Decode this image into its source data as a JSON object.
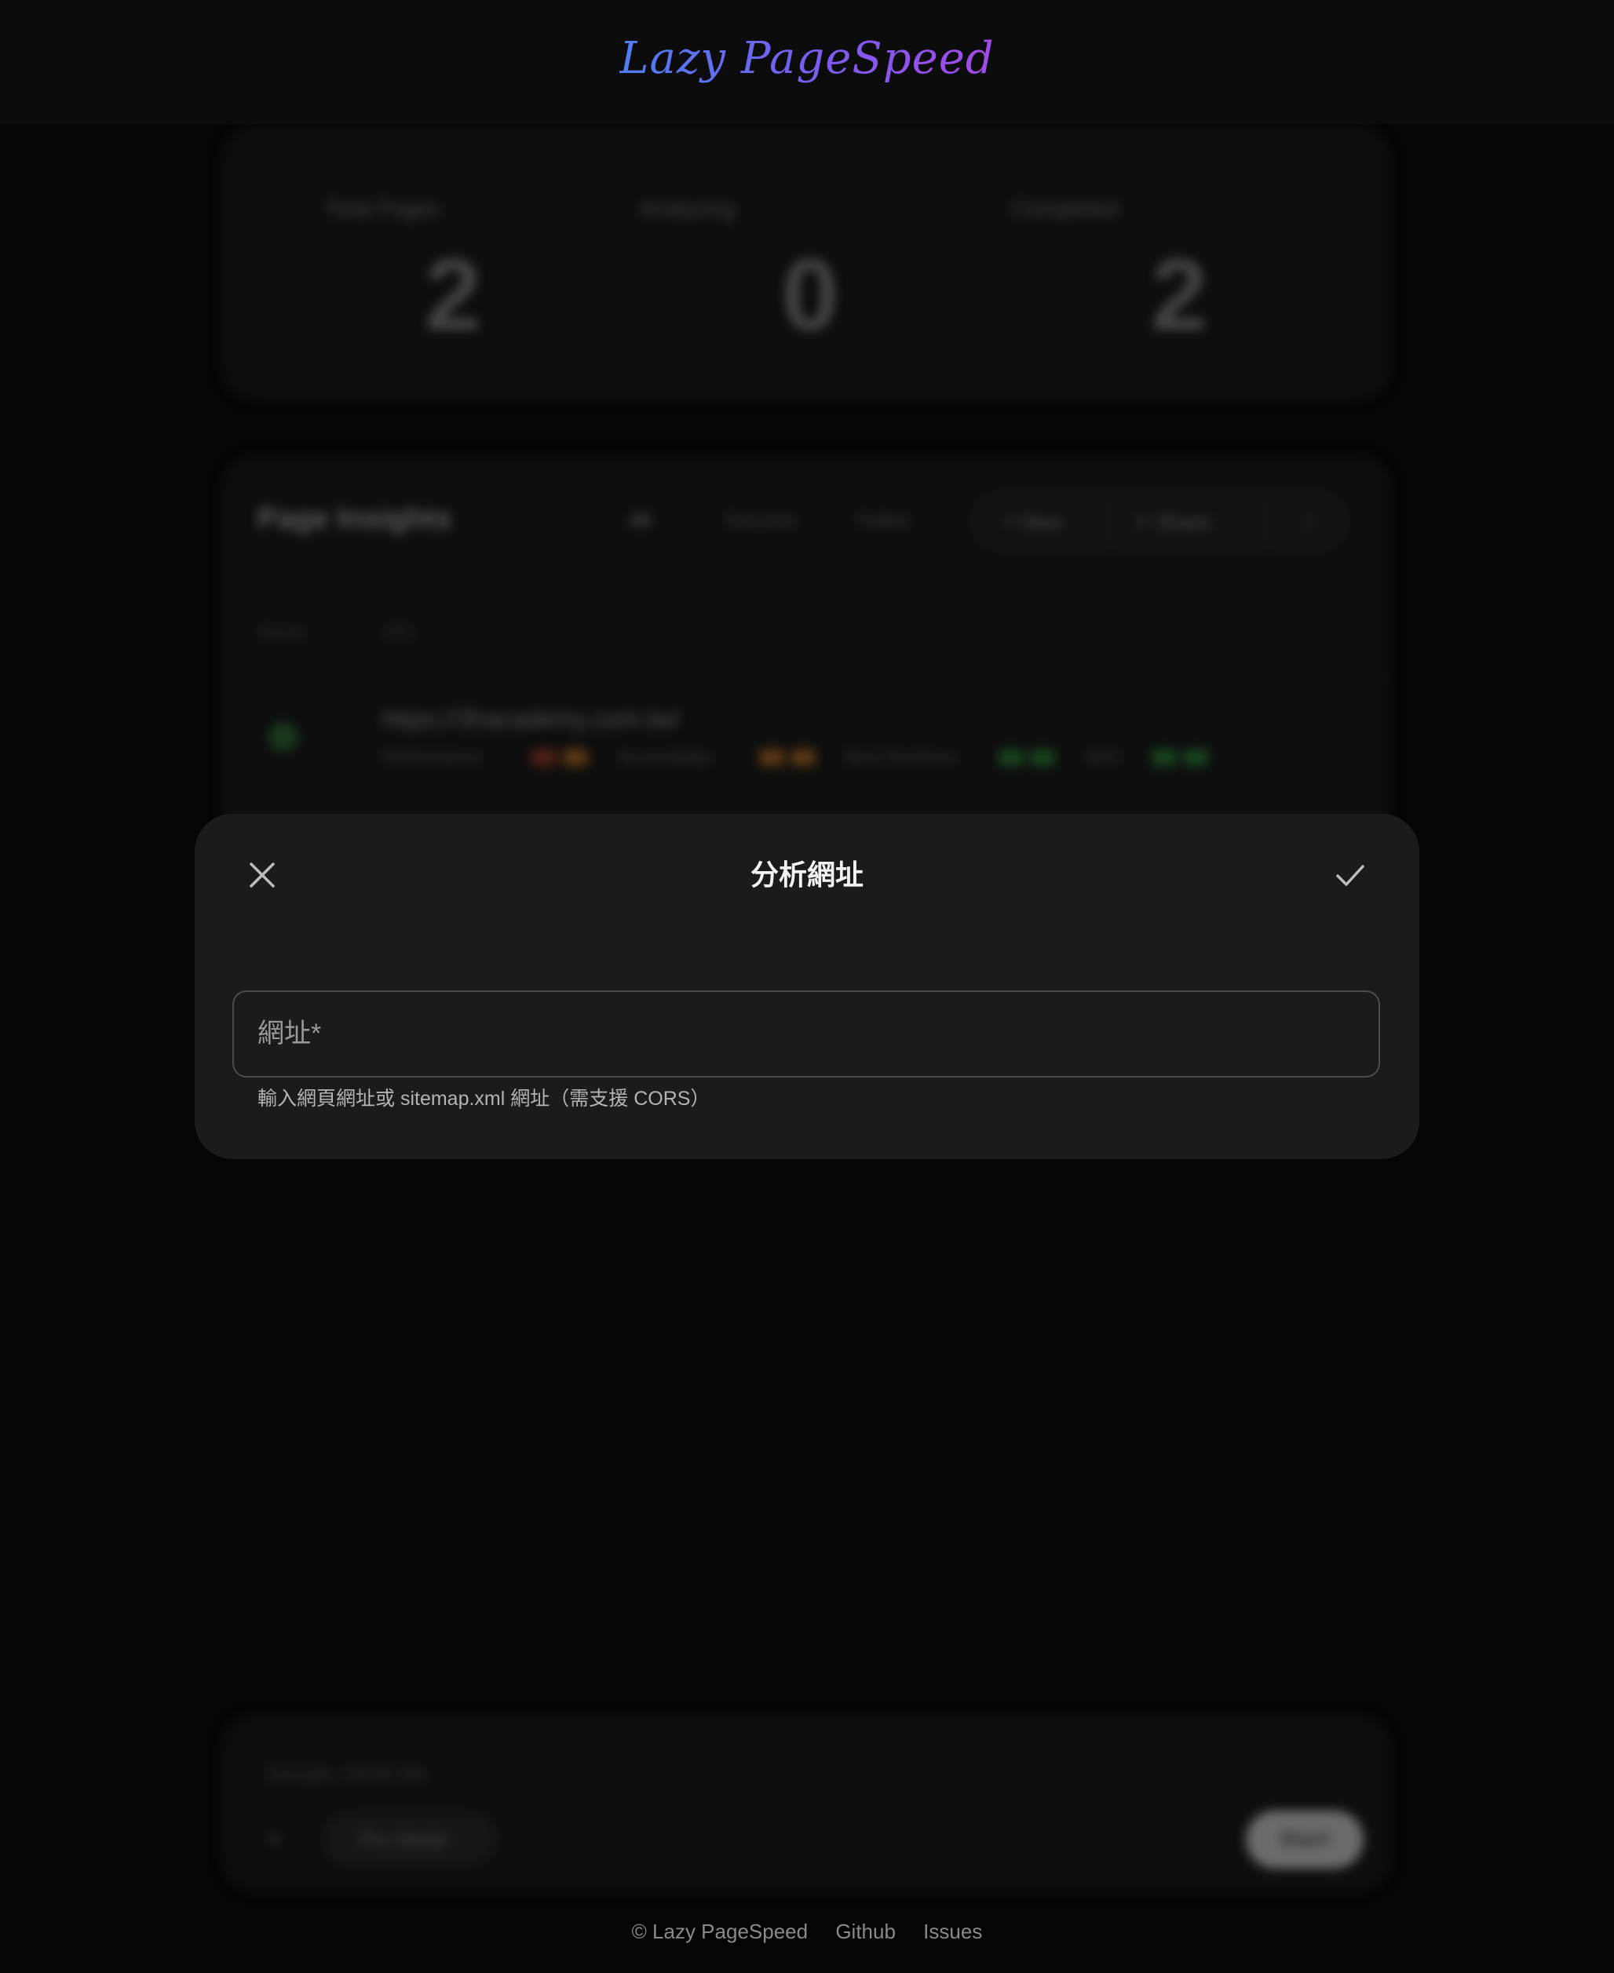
{
  "header": {
    "logo_text": "Lazy PageSpeed"
  },
  "stats": [
    {
      "label": "Total Pages",
      "value": "2"
    },
    {
      "label": "Analyzing",
      "value": "0"
    },
    {
      "label": "Completed",
      "value": "2"
    }
  ],
  "insights": {
    "title": "Page Insights",
    "tabs": [
      "All",
      "Success",
      "Failed"
    ],
    "buttons": [
      "New",
      "Share",
      "⋮"
    ],
    "columns": [
      "Status",
      "URL"
    ],
    "row": {
      "url": "https://3hacademy.com.tw/",
      "metrics": [
        "Performance",
        "Accessibility",
        "Best Practices",
        "SEO"
      ]
    },
    "colors": {
      "perf": "#8a4a1e",
      "access": "#8a5e1e",
      "good": "#1f5a28"
    }
  },
  "composer": {
    "placeholder": "Sample JSON file",
    "plus": "+",
    "pro_label": "Pro Mode",
    "start_label": "Start"
  },
  "modal": {
    "title": "分析網址",
    "close_icon": "close-icon",
    "confirm_icon": "check-icon",
    "url_placeholder": "網址*",
    "url_value": "",
    "helper_text": "輸入網頁網址或 sitemap.xml 網址（需支援 CORS）"
  },
  "footer": {
    "copyright": "© Lazy PageSpeed",
    "github": "Github",
    "issues": "Issues"
  }
}
